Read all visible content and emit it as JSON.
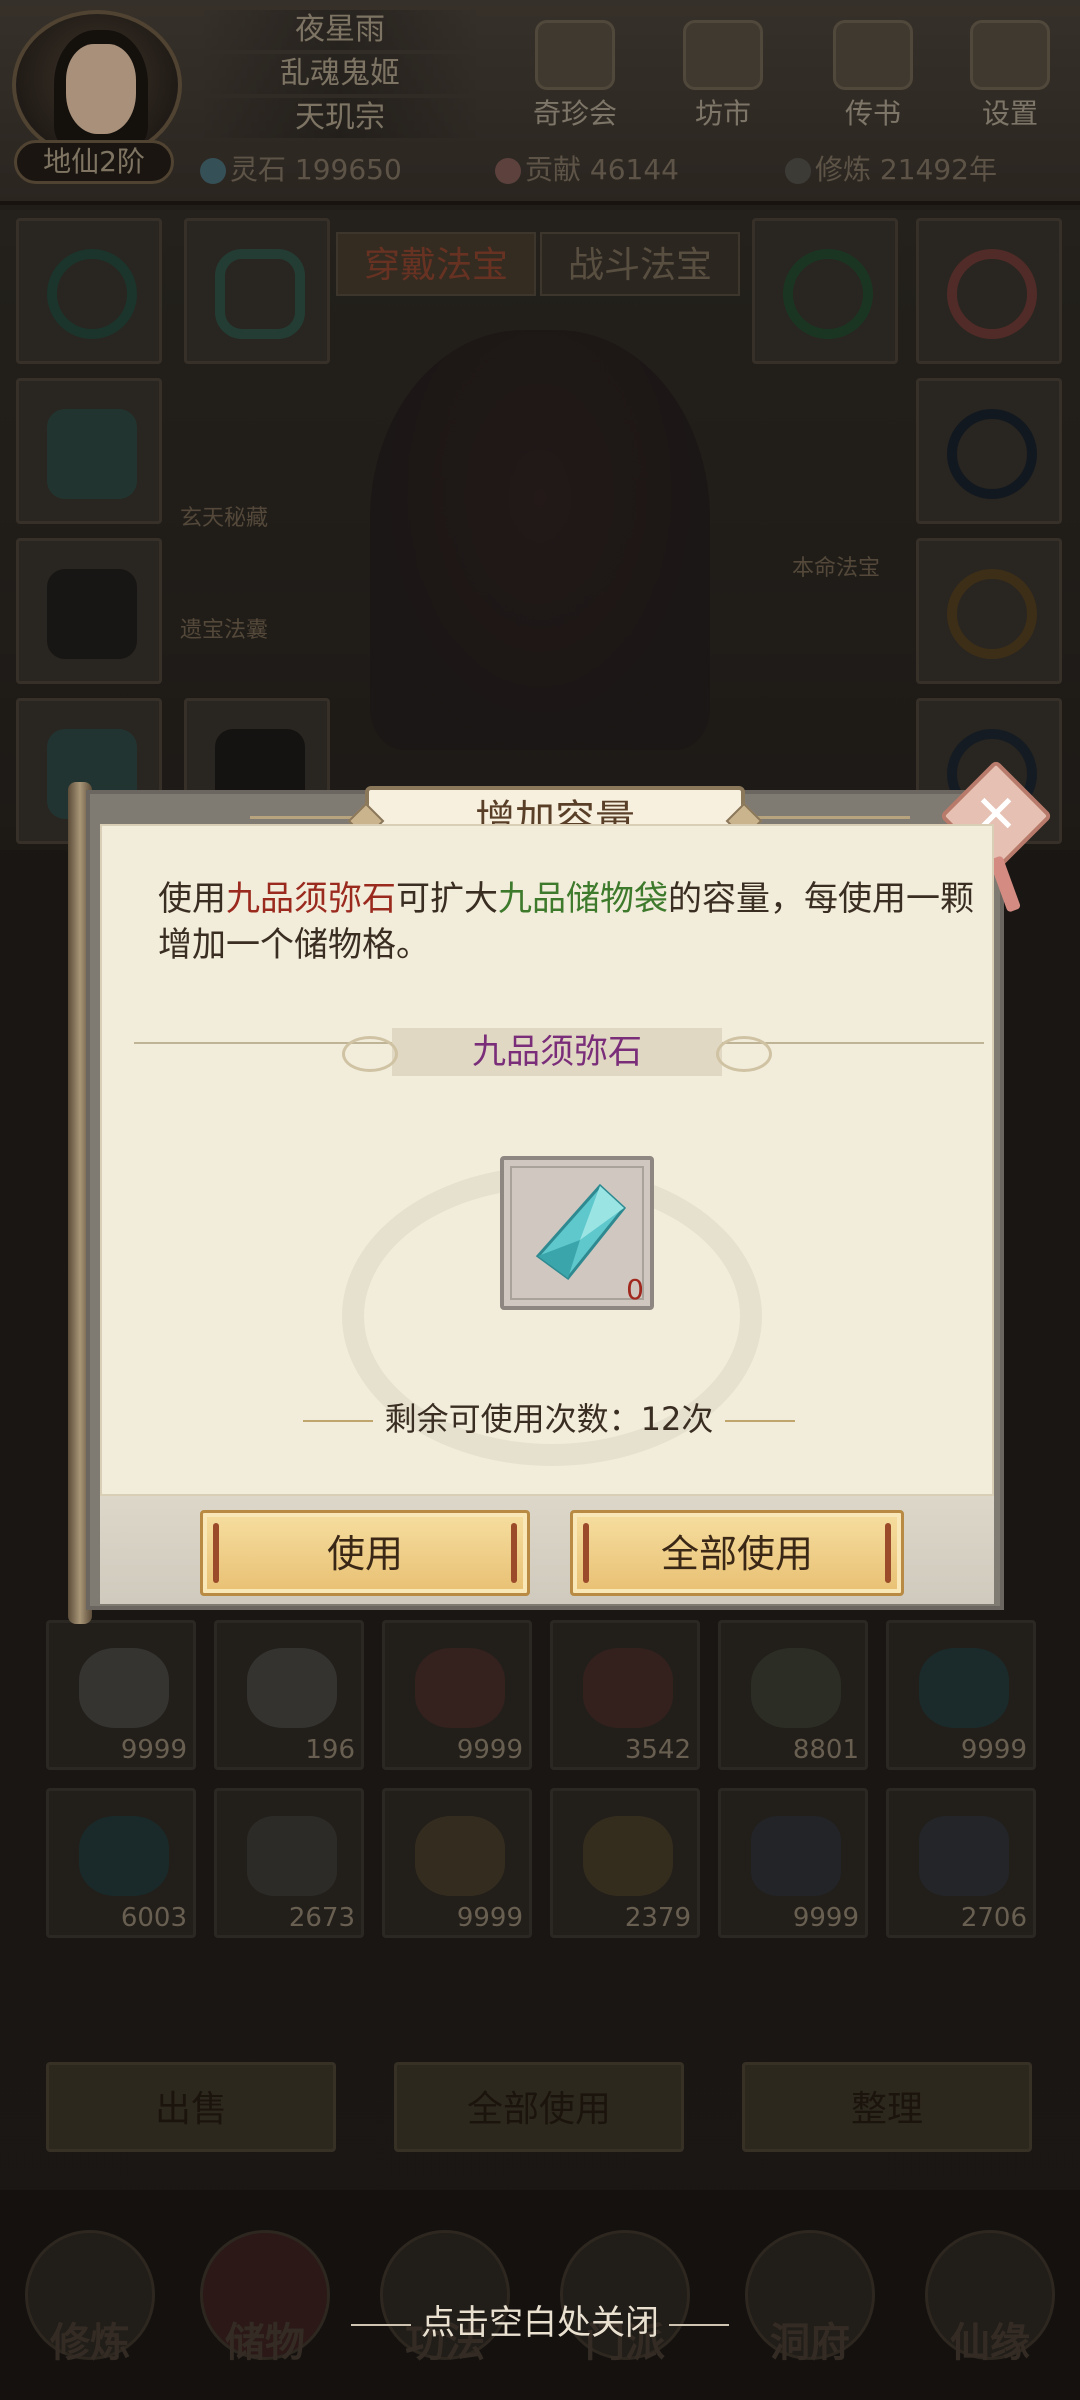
{
  "player": {
    "names": [
      "夜星雨",
      "乱魂鬼姬",
      "天玑宗"
    ],
    "realm": "地仙2阶"
  },
  "top_menu": [
    {
      "label": "奇珍会",
      "icon": "treasure-hall-icon"
    },
    {
      "label": "坊市",
      "icon": "market-icon"
    },
    {
      "label": "传书",
      "icon": "letter-icon"
    },
    {
      "label": "设置",
      "icon": "gear-icon"
    }
  ],
  "resources": {
    "spirit_stone": "灵石 199650",
    "contribution": "贡献 46144",
    "cultivation": "修炼 21492年"
  },
  "equip_tabs": [
    "穿戴法宝",
    "战斗法宝"
  ],
  "equip_side_labels": [
    "玄天秘藏",
    "遗宝法囊",
    "本命法宝"
  ],
  "inventory": {
    "row1": [
      "9999",
      "196",
      "9999",
      "3542",
      "8801",
      "9999"
    ],
    "row2": [
      "6003",
      "2673",
      "9999",
      "2379",
      "9999",
      "2706"
    ]
  },
  "actions": {
    "sell": "出售",
    "use_all": "全部使用",
    "sort": "整理"
  },
  "bottom_nav": [
    "修炼",
    "储物",
    "功法",
    "门派",
    "洞府",
    "仙缘"
  ],
  "modal": {
    "title": "增加容量",
    "desc_part1": "使用",
    "desc_item": "九品须弥石",
    "desc_part2": "可扩大",
    "desc_bag": "九品储物袋",
    "desc_part3": "的容量，每使用一颗增加一个储物格。",
    "item_name": "九品须弥石",
    "item_count": "0",
    "remaining": "剩余可使用次数：12次",
    "use_button": "使用",
    "use_all_button": "全部使用"
  },
  "close_hint": "点击空白处关闭",
  "colors": {
    "item_red": "#9b2a1e",
    "bag_green": "#3e7a2c",
    "item_purple": "#7a2e7a",
    "button_gold": "#e8c073"
  }
}
